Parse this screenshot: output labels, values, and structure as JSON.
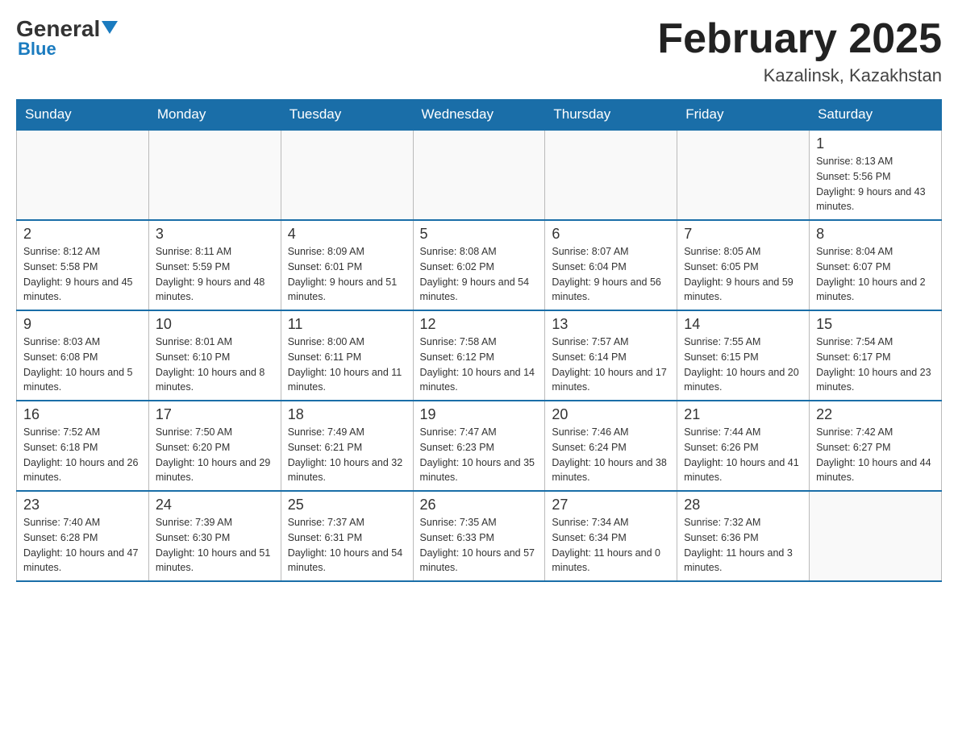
{
  "header": {
    "logo": {
      "general": "General",
      "blue": "Blue"
    },
    "title": "February 2025",
    "location": "Kazalinsk, Kazakhstan"
  },
  "days_of_week": [
    "Sunday",
    "Monday",
    "Tuesday",
    "Wednesday",
    "Thursday",
    "Friday",
    "Saturday"
  ],
  "weeks": [
    [
      {
        "day": null
      },
      {
        "day": null
      },
      {
        "day": null
      },
      {
        "day": null
      },
      {
        "day": null
      },
      {
        "day": null
      },
      {
        "day": 1,
        "sunrise": "Sunrise: 8:13 AM",
        "sunset": "Sunset: 5:56 PM",
        "daylight": "Daylight: 9 hours and 43 minutes."
      }
    ],
    [
      {
        "day": 2,
        "sunrise": "Sunrise: 8:12 AM",
        "sunset": "Sunset: 5:58 PM",
        "daylight": "Daylight: 9 hours and 45 minutes."
      },
      {
        "day": 3,
        "sunrise": "Sunrise: 8:11 AM",
        "sunset": "Sunset: 5:59 PM",
        "daylight": "Daylight: 9 hours and 48 minutes."
      },
      {
        "day": 4,
        "sunrise": "Sunrise: 8:09 AM",
        "sunset": "Sunset: 6:01 PM",
        "daylight": "Daylight: 9 hours and 51 minutes."
      },
      {
        "day": 5,
        "sunrise": "Sunrise: 8:08 AM",
        "sunset": "Sunset: 6:02 PM",
        "daylight": "Daylight: 9 hours and 54 minutes."
      },
      {
        "day": 6,
        "sunrise": "Sunrise: 8:07 AM",
        "sunset": "Sunset: 6:04 PM",
        "daylight": "Daylight: 9 hours and 56 minutes."
      },
      {
        "day": 7,
        "sunrise": "Sunrise: 8:05 AM",
        "sunset": "Sunset: 6:05 PM",
        "daylight": "Daylight: 9 hours and 59 minutes."
      },
      {
        "day": 8,
        "sunrise": "Sunrise: 8:04 AM",
        "sunset": "Sunset: 6:07 PM",
        "daylight": "Daylight: 10 hours and 2 minutes."
      }
    ],
    [
      {
        "day": 9,
        "sunrise": "Sunrise: 8:03 AM",
        "sunset": "Sunset: 6:08 PM",
        "daylight": "Daylight: 10 hours and 5 minutes."
      },
      {
        "day": 10,
        "sunrise": "Sunrise: 8:01 AM",
        "sunset": "Sunset: 6:10 PM",
        "daylight": "Daylight: 10 hours and 8 minutes."
      },
      {
        "day": 11,
        "sunrise": "Sunrise: 8:00 AM",
        "sunset": "Sunset: 6:11 PM",
        "daylight": "Daylight: 10 hours and 11 minutes."
      },
      {
        "day": 12,
        "sunrise": "Sunrise: 7:58 AM",
        "sunset": "Sunset: 6:12 PM",
        "daylight": "Daylight: 10 hours and 14 minutes."
      },
      {
        "day": 13,
        "sunrise": "Sunrise: 7:57 AM",
        "sunset": "Sunset: 6:14 PM",
        "daylight": "Daylight: 10 hours and 17 minutes."
      },
      {
        "day": 14,
        "sunrise": "Sunrise: 7:55 AM",
        "sunset": "Sunset: 6:15 PM",
        "daylight": "Daylight: 10 hours and 20 minutes."
      },
      {
        "day": 15,
        "sunrise": "Sunrise: 7:54 AM",
        "sunset": "Sunset: 6:17 PM",
        "daylight": "Daylight: 10 hours and 23 minutes."
      }
    ],
    [
      {
        "day": 16,
        "sunrise": "Sunrise: 7:52 AM",
        "sunset": "Sunset: 6:18 PM",
        "daylight": "Daylight: 10 hours and 26 minutes."
      },
      {
        "day": 17,
        "sunrise": "Sunrise: 7:50 AM",
        "sunset": "Sunset: 6:20 PM",
        "daylight": "Daylight: 10 hours and 29 minutes."
      },
      {
        "day": 18,
        "sunrise": "Sunrise: 7:49 AM",
        "sunset": "Sunset: 6:21 PM",
        "daylight": "Daylight: 10 hours and 32 minutes."
      },
      {
        "day": 19,
        "sunrise": "Sunrise: 7:47 AM",
        "sunset": "Sunset: 6:23 PM",
        "daylight": "Daylight: 10 hours and 35 minutes."
      },
      {
        "day": 20,
        "sunrise": "Sunrise: 7:46 AM",
        "sunset": "Sunset: 6:24 PM",
        "daylight": "Daylight: 10 hours and 38 minutes."
      },
      {
        "day": 21,
        "sunrise": "Sunrise: 7:44 AM",
        "sunset": "Sunset: 6:26 PM",
        "daylight": "Daylight: 10 hours and 41 minutes."
      },
      {
        "day": 22,
        "sunrise": "Sunrise: 7:42 AM",
        "sunset": "Sunset: 6:27 PM",
        "daylight": "Daylight: 10 hours and 44 minutes."
      }
    ],
    [
      {
        "day": 23,
        "sunrise": "Sunrise: 7:40 AM",
        "sunset": "Sunset: 6:28 PM",
        "daylight": "Daylight: 10 hours and 47 minutes."
      },
      {
        "day": 24,
        "sunrise": "Sunrise: 7:39 AM",
        "sunset": "Sunset: 6:30 PM",
        "daylight": "Daylight: 10 hours and 51 minutes."
      },
      {
        "day": 25,
        "sunrise": "Sunrise: 7:37 AM",
        "sunset": "Sunset: 6:31 PM",
        "daylight": "Daylight: 10 hours and 54 minutes."
      },
      {
        "day": 26,
        "sunrise": "Sunrise: 7:35 AM",
        "sunset": "Sunset: 6:33 PM",
        "daylight": "Daylight: 10 hours and 57 minutes."
      },
      {
        "day": 27,
        "sunrise": "Sunrise: 7:34 AM",
        "sunset": "Sunset: 6:34 PM",
        "daylight": "Daylight: 11 hours and 0 minutes."
      },
      {
        "day": 28,
        "sunrise": "Sunrise: 7:32 AM",
        "sunset": "Sunset: 6:36 PM",
        "daylight": "Daylight: 11 hours and 3 minutes."
      },
      {
        "day": null
      }
    ]
  ]
}
